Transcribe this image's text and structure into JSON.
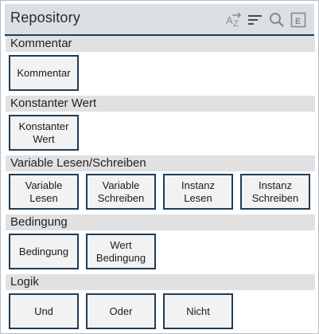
{
  "header": {
    "title": "Repository",
    "icons": [
      "sort-alpha-icon",
      "sort-list-icon",
      "search-icon",
      "expand-icon"
    ]
  },
  "sections": [
    {
      "label": "Kommentar",
      "tiles": [
        "Kommentar"
      ]
    },
    {
      "label": "Konstanter Wert",
      "tiles": [
        "Konstanter\nWert"
      ]
    },
    {
      "label": "Variable Lesen/Schreiben",
      "tiles": [
        "Variable\nLesen",
        "Variable\nSchreiben",
        "Instanz\nLesen",
        "Instanz\nSchreiben"
      ]
    },
    {
      "label": "Bedingung",
      "tiles": [
        "Bedingung",
        "Wert\nBedingung"
      ]
    },
    {
      "label": "Logik",
      "tiles": [
        "Und",
        "Oder",
        "Nicht"
      ]
    }
  ],
  "colors": {
    "accent": "#1f3d57",
    "header_bg": "#dde0e3",
    "section_bg": "#e1e1e1",
    "tile_bg": "#f2f2f2",
    "icon": "#7d7d7d"
  }
}
